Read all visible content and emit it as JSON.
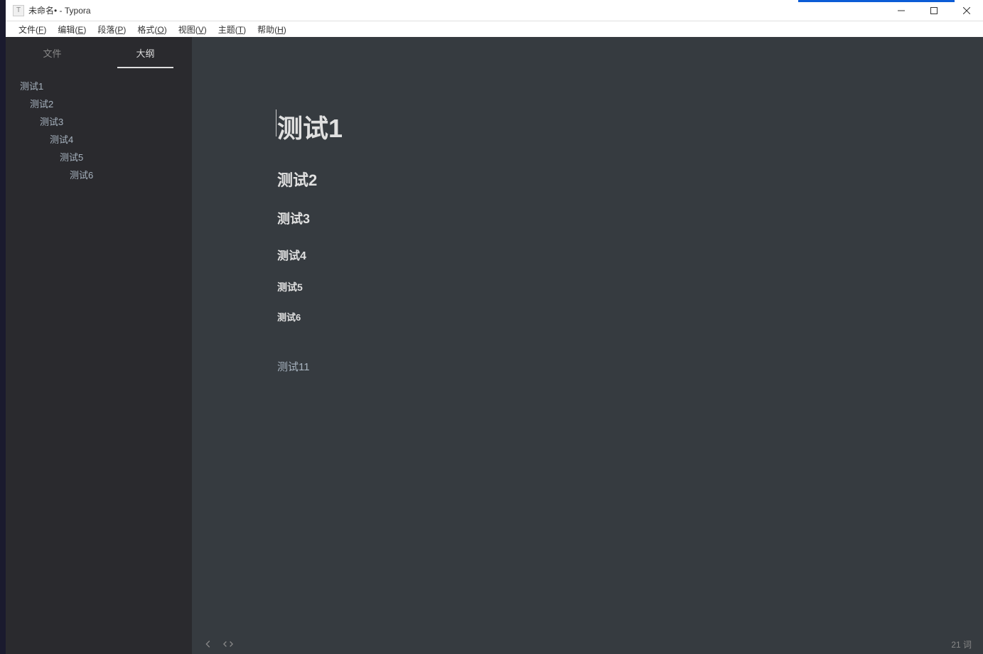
{
  "window": {
    "title": "未命名• - Typora",
    "app_icon_letter": "T"
  },
  "menu": {
    "items": [
      {
        "label": "文件(",
        "accel": "F",
        "suffix": ")"
      },
      {
        "label": "编辑(",
        "accel": "E",
        "suffix": ")"
      },
      {
        "label": "段落(",
        "accel": "P",
        "suffix": ")"
      },
      {
        "label": "格式(",
        "accel": "O",
        "suffix": ")"
      },
      {
        "label": "视图(",
        "accel": "V",
        "suffix": ")"
      },
      {
        "label": "主题(",
        "accel": "T",
        "suffix": ")"
      },
      {
        "label": "帮助(",
        "accel": "H",
        "suffix": ")"
      }
    ]
  },
  "sidebar": {
    "tabs": {
      "files": "文件",
      "outline": "大纲"
    },
    "outline": [
      {
        "label": "测试1",
        "indent": 20
      },
      {
        "label": "测试2",
        "indent": 34
      },
      {
        "label": "测试3",
        "indent": 48
      },
      {
        "label": "测试4",
        "indent": 62
      },
      {
        "label": "测试5",
        "indent": 76
      },
      {
        "label": "测试6",
        "indent": 90
      }
    ]
  },
  "editor": {
    "h1": "测试1",
    "h2": "测试2",
    "h3": "测试3",
    "h4": "测试4",
    "h5": "测试5",
    "h6": "测试6",
    "p": "测试11"
  },
  "status": {
    "word_count": "21 词"
  }
}
